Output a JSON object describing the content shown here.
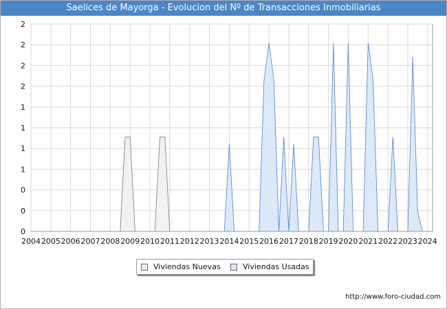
{
  "header": {
    "title": "Saelices de Mayorga - Evolucion del Nº de Transacciones Inmobiliarias"
  },
  "footer": {
    "url": "http://www.foro-ciudad.com"
  },
  "chart_data": {
    "type": "area",
    "title": "Saelices de Mayorga - Evolucion del Nº de Transacciones Inmobiliarias",
    "xlabel": "",
    "ylabel": "",
    "x_ticks": [
      "2004",
      "2005",
      "2006",
      "2007",
      "2008",
      "2009",
      "2010",
      "2011",
      "2012",
      "2013",
      "2014",
      "2015",
      "2016",
      "2017",
      "2018",
      "2019",
      "2020",
      "2021",
      "2022",
      "2023",
      "2024"
    ],
    "y_tick_labels": [
      "0",
      "0",
      "0",
      "1",
      "1",
      "1",
      "1",
      "2",
      "2",
      "2",
      "2"
    ],
    "ylim": [
      0,
      2.2
    ],
    "grid": true,
    "legend_position": "bottom",
    "series": [
      {
        "name": "Viviendas Nuevas",
        "fill": "#f2f2f2",
        "stroke": "#777777",
        "points": [
          [
            2008.5,
            0
          ],
          [
            2008.75,
            1
          ],
          [
            2009.0,
            1
          ],
          [
            2009.25,
            0
          ],
          [
            2010.25,
            0
          ],
          [
            2010.5,
            1
          ],
          [
            2010.75,
            1
          ],
          [
            2011.0,
            0
          ]
        ]
      },
      {
        "name": "Viviendas Usadas",
        "fill": "#dbe9fb",
        "stroke": "#4f83c9",
        "points": [
          [
            2013.75,
            0
          ],
          [
            2014.0,
            0.93
          ],
          [
            2014.25,
            0
          ],
          [
            2015.5,
            0
          ],
          [
            2015.75,
            1.6
          ],
          [
            2016.0,
            2.0
          ],
          [
            2016.25,
            1.6
          ],
          [
            2016.5,
            0
          ],
          [
            2016.75,
            1.0
          ],
          [
            2017.0,
            0
          ],
          [
            2017.25,
            0.93
          ],
          [
            2017.5,
            0
          ],
          [
            2018.0,
            0
          ],
          [
            2018.25,
            1.0
          ],
          [
            2018.5,
            1.0
          ],
          [
            2018.75,
            0
          ],
          [
            2019.0,
            0
          ],
          [
            2019.25,
            2.0
          ],
          [
            2019.5,
            0
          ],
          [
            2019.75,
            0
          ],
          [
            2020.0,
            2.0
          ],
          [
            2020.25,
            0
          ],
          [
            2020.75,
            0
          ],
          [
            2021.0,
            2.0
          ],
          [
            2021.25,
            1.6
          ],
          [
            2021.5,
            0
          ],
          [
            2022.0,
            0
          ],
          [
            2022.25,
            1.0
          ],
          [
            2022.5,
            0
          ],
          [
            2023.0,
            0
          ],
          [
            2023.25,
            1.85
          ],
          [
            2023.5,
            0.2
          ],
          [
            2023.75,
            0
          ]
        ]
      }
    ]
  }
}
